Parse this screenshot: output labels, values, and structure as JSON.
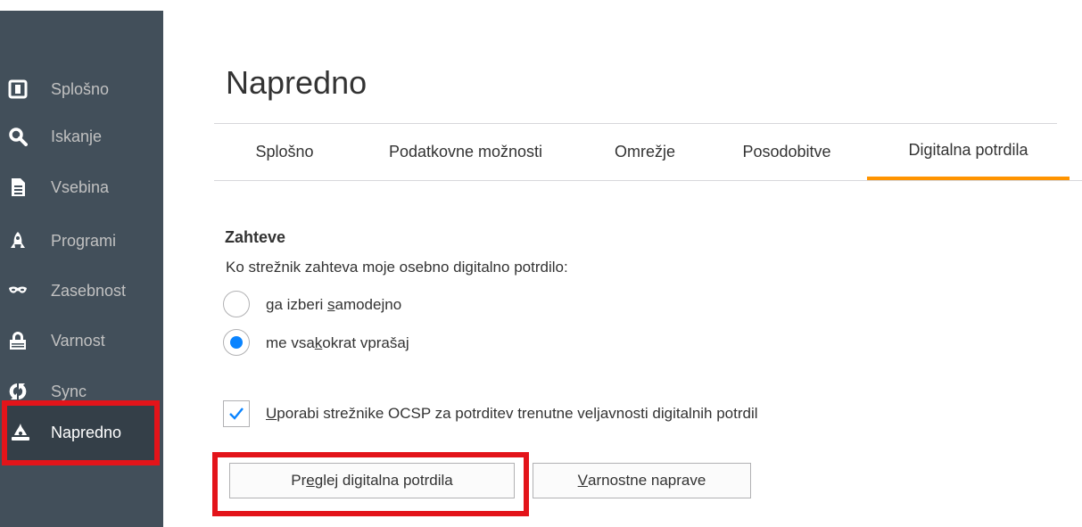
{
  "sidebar": {
    "items": [
      {
        "label": "Splošno",
        "icon": "general-icon"
      },
      {
        "label": "Iskanje",
        "icon": "search-icon"
      },
      {
        "label": "Vsebina",
        "icon": "document-icon"
      },
      {
        "label": "Programi",
        "icon": "rocket-icon"
      },
      {
        "label": "Zasebnost",
        "icon": "mask-icon"
      },
      {
        "label": "Varnost",
        "icon": "lock-icon"
      },
      {
        "label": "Sync",
        "icon": "sync-icon"
      },
      {
        "label": "Napredno",
        "icon": "wizard-hat-icon"
      }
    ],
    "selected": "Napredno"
  },
  "page": {
    "title": "Napredno"
  },
  "tabs": [
    "Splošno",
    "Podatkovne možnosti",
    "Omrežje",
    "Posodobitve",
    "Digitalna potrdila"
  ],
  "selected_tab": "Digitalna potrdila",
  "requests": {
    "heading": "Zahteve",
    "question": "Ko strežnik zahteva moje osebno digitalno potrdilo:",
    "option1": {
      "pre": "ga izberi ",
      "key": "s",
      "post": "amodejno"
    },
    "option2": {
      "pre": "me vsa",
      "key": "k",
      "post": "okrat vprašaj"
    },
    "selected_option": 2
  },
  "ocsp": {
    "key": "U",
    "post": "porabi strežnike OCSP za potrditev trenutne veljavnosti digitalnih potrdil",
    "checked": true
  },
  "buttons": {
    "view": {
      "pre": "Pr",
      "key": "e",
      "post": "glej digitalna potrdila"
    },
    "devices": {
      "pre": "",
      "key": "V",
      "post": "arnostne naprave"
    }
  },
  "colors": {
    "accent": "#ff9400",
    "highlight": "#e3141a",
    "radio": "#0a84ff",
    "sidebar": "#424f5a"
  }
}
